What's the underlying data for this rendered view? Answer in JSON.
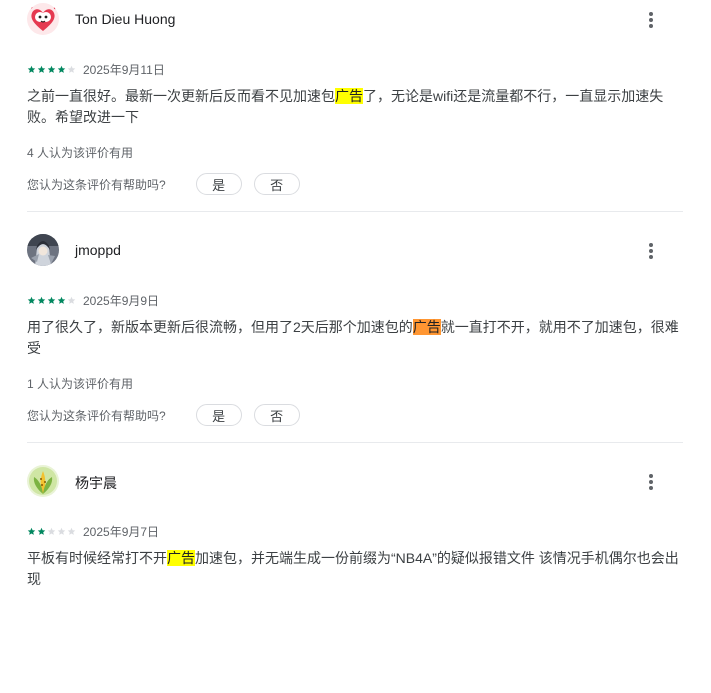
{
  "colors": {
    "star_filled": "#01875f",
    "star_empty": "#dadce0",
    "highlight": "#ffff00",
    "highlight_active": "#ff9632"
  },
  "reviews": [
    {
      "name": "Ton Dieu Huong",
      "avatar_icon": "red-heart-cat-avatar",
      "rating": 4,
      "date": "2025年9月11日",
      "text_before": "之前一直很好。最新一次更新后反而看不见加速包",
      "highlight": "广告",
      "text_after": "了，无论是wifi还是流量都不行，一直显示加速失败。希望改进一下",
      "helpful_count": "4 人认为该评价有用",
      "helpful_question": "您认为这条评价有帮助吗?",
      "yes_label": "是",
      "no_label": "否"
    },
    {
      "name": "jmoppd",
      "avatar_icon": "anime-character-avatar",
      "rating": 4,
      "date": "2025年9月9日",
      "text_before": "用了很久了，新版本更新后很流畅，但用了2天后那个加速包的",
      "highlight": "广告",
      "text_after": "就一直打不开，就用不了加速包，很难受",
      "helpful_count": "1 人认为该评价有用",
      "helpful_question": "您认为这条评价有帮助吗?",
      "yes_label": "是",
      "no_label": "否"
    },
    {
      "name": "杨宇晨",
      "avatar_icon": "yellow-plant-avatar",
      "rating": 2,
      "date": "2025年9月7日",
      "text_before": "平板有时候经常打不开",
      "highlight": "广告",
      "text_after": "加速包，并无端生成一份前缀为“NB4A”的疑似报错文件 该情况手机偶尔也会出现"
    }
  ]
}
